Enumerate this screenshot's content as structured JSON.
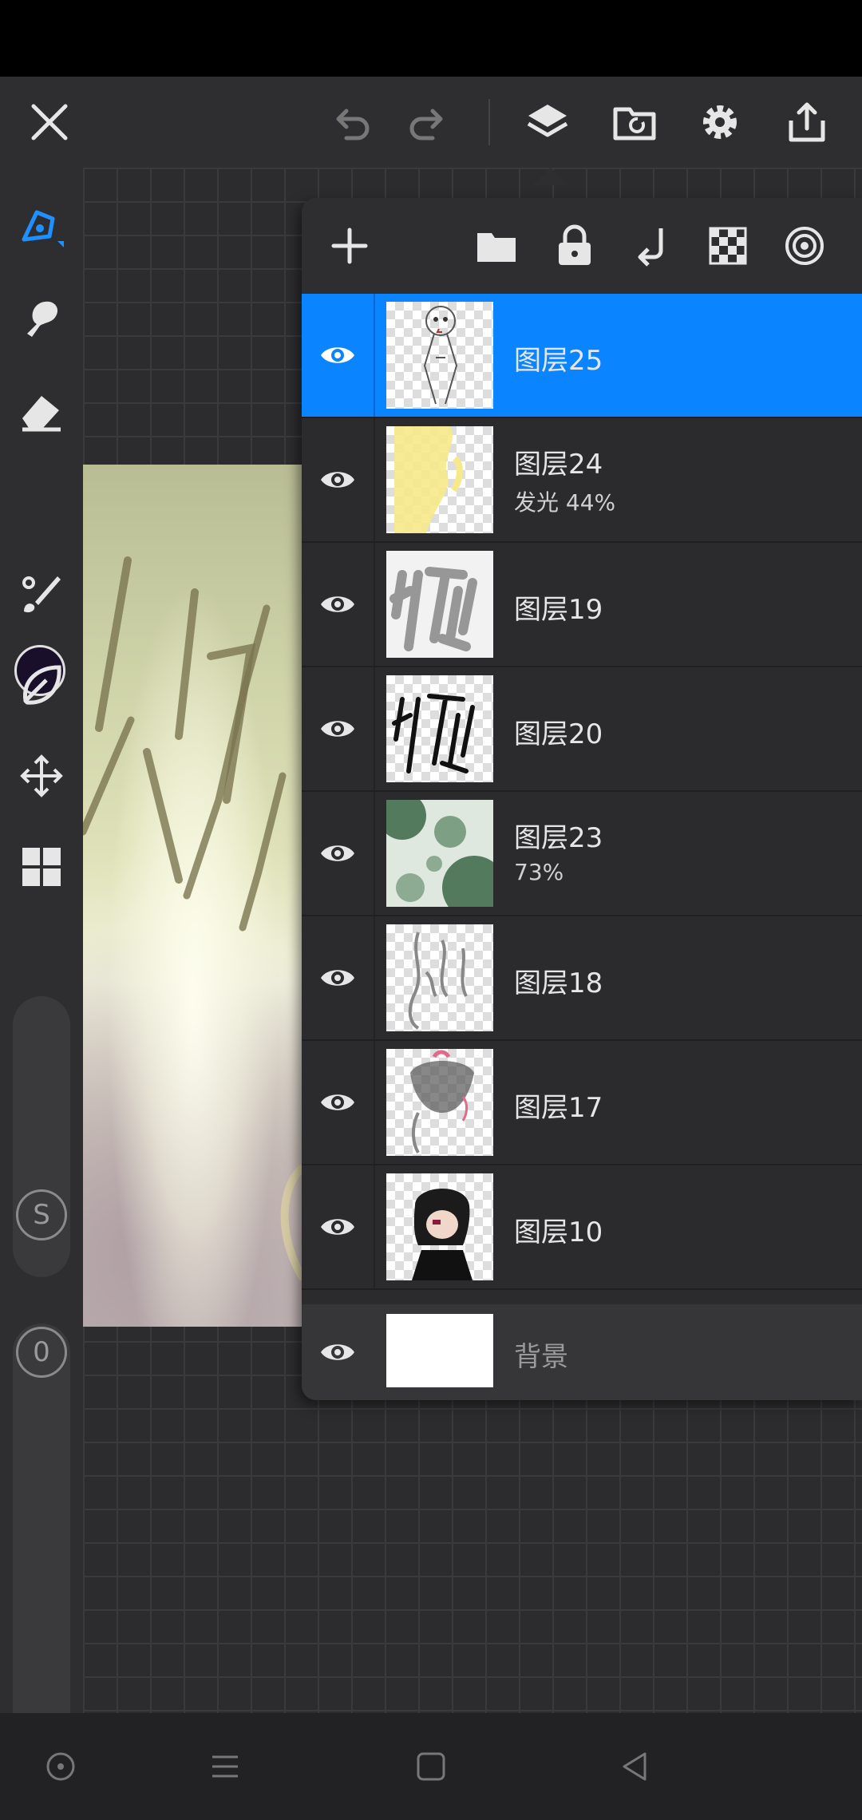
{
  "colors": {
    "accent": "#0a84ff",
    "selected_pen": "#1e90ff",
    "current_color": "#1a0f2b"
  },
  "toolbar": {
    "close": "close-icon",
    "undo": "undo-icon",
    "redo": "redo-icon",
    "layers": "layers-icon",
    "import": "import-icon",
    "settings": "gear-icon",
    "share": "share-icon"
  },
  "side_tools": [
    "pen-icon",
    "smudge-icon",
    "eraser-icon",
    "color-swatch",
    "brush-settings-icon",
    "leaf-icon",
    "transform-icon",
    "grid-icon"
  ],
  "sliders": {
    "size_label": "S",
    "opacity_label": "0"
  },
  "layers_panel": {
    "actions": [
      "add-layer-icon",
      "folder-icon",
      "lock-icon",
      "merge-down-icon",
      "transparency-icon",
      "target-icon"
    ],
    "layers": [
      {
        "name": "图层25",
        "sub": "",
        "selected": true
      },
      {
        "name": "图层24",
        "sub": "发光    44%",
        "selected": false
      },
      {
        "name": "图层19",
        "sub": "",
        "selected": false
      },
      {
        "name": "图层20",
        "sub": "",
        "selected": false
      },
      {
        "name": "图层23",
        "sub": "73%",
        "selected": false
      },
      {
        "name": "图层18",
        "sub": "",
        "selected": false
      },
      {
        "name": "图层17",
        "sub": "",
        "selected": false
      },
      {
        "name": "图层10",
        "sub": "",
        "selected": false
      }
    ],
    "background": {
      "name": "背景"
    }
  },
  "navbar": [
    "circle-icon",
    "menu-icon",
    "square-icon",
    "back-icon"
  ]
}
